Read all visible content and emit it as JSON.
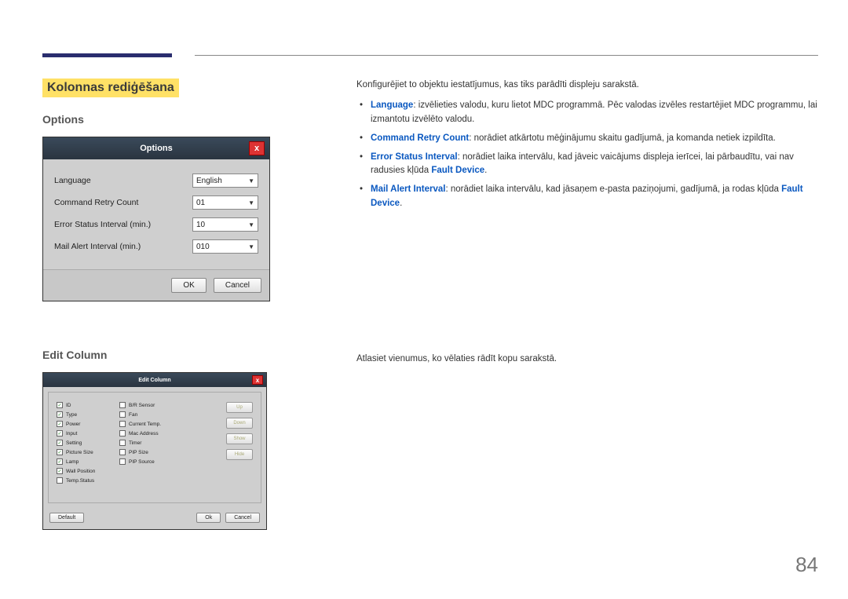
{
  "page": {
    "number": "84",
    "sectionTitle": "Kolonnas rediģēšana"
  },
  "options": {
    "heading": "Options",
    "dialogTitle": "Options",
    "rows": {
      "language": {
        "label": "Language",
        "value": "English"
      },
      "retry": {
        "label": "Command Retry Count",
        "value": "01"
      },
      "errorInt": {
        "label": "Error Status Interval (min.)",
        "value": "10"
      },
      "mailInt": {
        "label": "Mail Alert Interval (min.)",
        "value": "010"
      }
    },
    "buttons": {
      "ok": "OK",
      "cancel": "Cancel",
      "close": "x"
    }
  },
  "editColumn": {
    "heading": "Edit Column",
    "dialogTitle": "Edit Column",
    "col1": [
      {
        "label": "ID",
        "checked": true
      },
      {
        "label": "Type",
        "checked": true
      },
      {
        "label": "Power",
        "checked": true
      },
      {
        "label": "Input",
        "checked": true
      },
      {
        "label": "Setting",
        "checked": true
      },
      {
        "label": "Picture Size",
        "checked": true
      },
      {
        "label": "Lamp",
        "checked": true
      },
      {
        "label": "Wall Position",
        "checked": true
      },
      {
        "label": "Temp.Status",
        "checked": false
      }
    ],
    "col2": [
      {
        "label": "B/R Sensor",
        "checked": false
      },
      {
        "label": "Fan",
        "checked": false
      },
      {
        "label": "Current Temp.",
        "checked": false
      },
      {
        "label": "Mac Address",
        "checked": false
      },
      {
        "label": "Timer",
        "checked": false
      },
      {
        "label": "PIP Size",
        "checked": false
      },
      {
        "label": "PIP Source",
        "checked": false
      }
    ],
    "sideButtons": {
      "up": "Up",
      "down": "Down",
      "show": "Show",
      "hide": "Hide"
    },
    "footer": {
      "default": "Default",
      "ok": "Ok",
      "cancel": "Cancel"
    }
  },
  "descriptions": {
    "intro": "Konfigurējiet to objektu iestatījumus, kas tiks parādīti displeju sarakstā.",
    "languageTerm": "Language",
    "languageText": ": izvēlieties valodu, kuru lietot MDC programmā. Pēc valodas izvēles restartējiet MDC programmu, lai izmantotu izvēlēto valodu.",
    "retryTerm": "Command Retry Count",
    "retryText": ": norādiet atkārtotu mēģinājumu skaitu gadījumā, ja komanda netiek izpildīta.",
    "errorTerm": "Error Status Interval",
    "errorText": ": norādiet laika intervālu, kad jāveic vaicājums displeja ierīcei, lai pārbaudītu, vai nav radusies kļūda ",
    "faultDevice": "Fault Device",
    "dot": ".",
    "mailTerm": "Mail Alert Interval",
    "mailText": ": norādiet laika intervālu, kad jāsaņem e-pasta paziņojumi, gadījumā, ja rodas kļūda ",
    "editDesc": "Atlasiet vienumus, ko vēlaties rādīt kopu sarakstā."
  }
}
